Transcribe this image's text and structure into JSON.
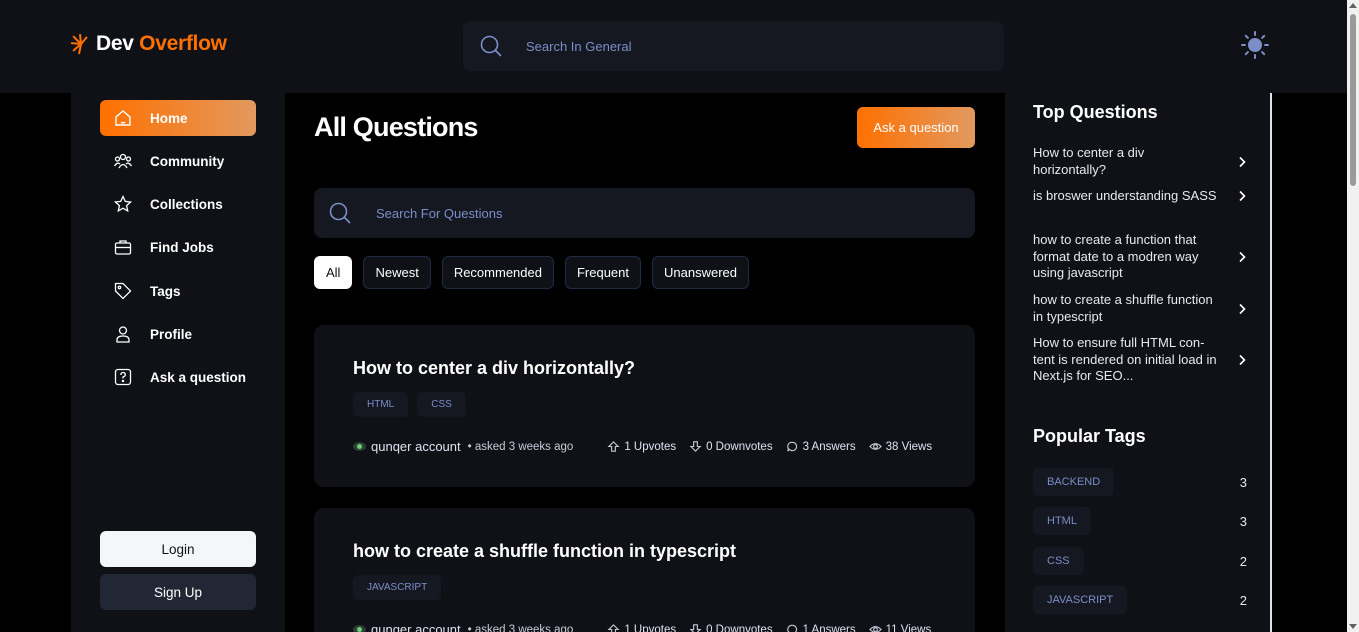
{
  "header": {
    "logo_dev": "Dev",
    "logo_overflow": "Overflow",
    "search_placeholder": "Search In General"
  },
  "sidebar": {
    "items": [
      {
        "label": "Home",
        "icon": "home-icon",
        "active": true
      },
      {
        "label": "Community",
        "icon": "users-icon"
      },
      {
        "label": "Collections",
        "icon": "star-icon"
      },
      {
        "label": "Find Jobs",
        "icon": "briefcase-icon"
      },
      {
        "label": "Tags",
        "icon": "tag-icon"
      },
      {
        "label": "Profile",
        "icon": "user-icon"
      },
      {
        "label": "Ask a question",
        "icon": "question-icon"
      }
    ],
    "login_label": "Login",
    "signup_label": "Sign Up"
  },
  "main": {
    "title": "All Questions",
    "ask_button": "Ask a question",
    "search_placeholder": "Search For Questions",
    "filters": [
      "All",
      "Newest",
      "Recommended",
      "Frequent",
      "Unanswered"
    ],
    "active_filter": "All",
    "questions": [
      {
        "title": "How to center a div horizontally?",
        "tags": [
          "HTML",
          "CSS"
        ],
        "author": "qunqer account",
        "asked": "• asked 3 weeks ago",
        "upvotes": "1 Upvotes",
        "downvotes": "0 Downvotes",
        "answers": "3 Answers",
        "views": "38 Views"
      },
      {
        "title": "how to create a shuffle function in typescript",
        "tags": [
          "JAVASCRIPT"
        ],
        "author": "qunqer account",
        "asked": "• asked 3 weeks ago",
        "upvotes": "1 Upvotes",
        "downvotes": "0 Downvotes",
        "answers": "1 Answers",
        "views": "11 Views"
      }
    ]
  },
  "right_sidebar": {
    "top_questions_title": "Top Questions",
    "top_questions": [
      "How to center a div horizontally?",
      "is broswer understanding SASS",
      "how to create a function that format date to a modren way using javascript",
      "how to create a shuffle func­tion in typescript",
      "How to ensure full HTML con­tent is rendered on initial load in Next.js for SEO..."
    ],
    "popular_tags_title": "Popular Tags",
    "popular_tags": [
      {
        "name": "BACKEND",
        "count": "3"
      },
      {
        "name": "HTML",
        "count": "3"
      },
      {
        "name": "CSS",
        "count": "2"
      },
      {
        "name": "JAVASCRIPT",
        "count": "2"
      }
    ]
  },
  "colors": {
    "brand": "#ff7000",
    "brand_gradient_end": "#e2995f",
    "panel": "#0f1117",
    "input": "#151821",
    "tag_text": "#7b8ec8"
  }
}
